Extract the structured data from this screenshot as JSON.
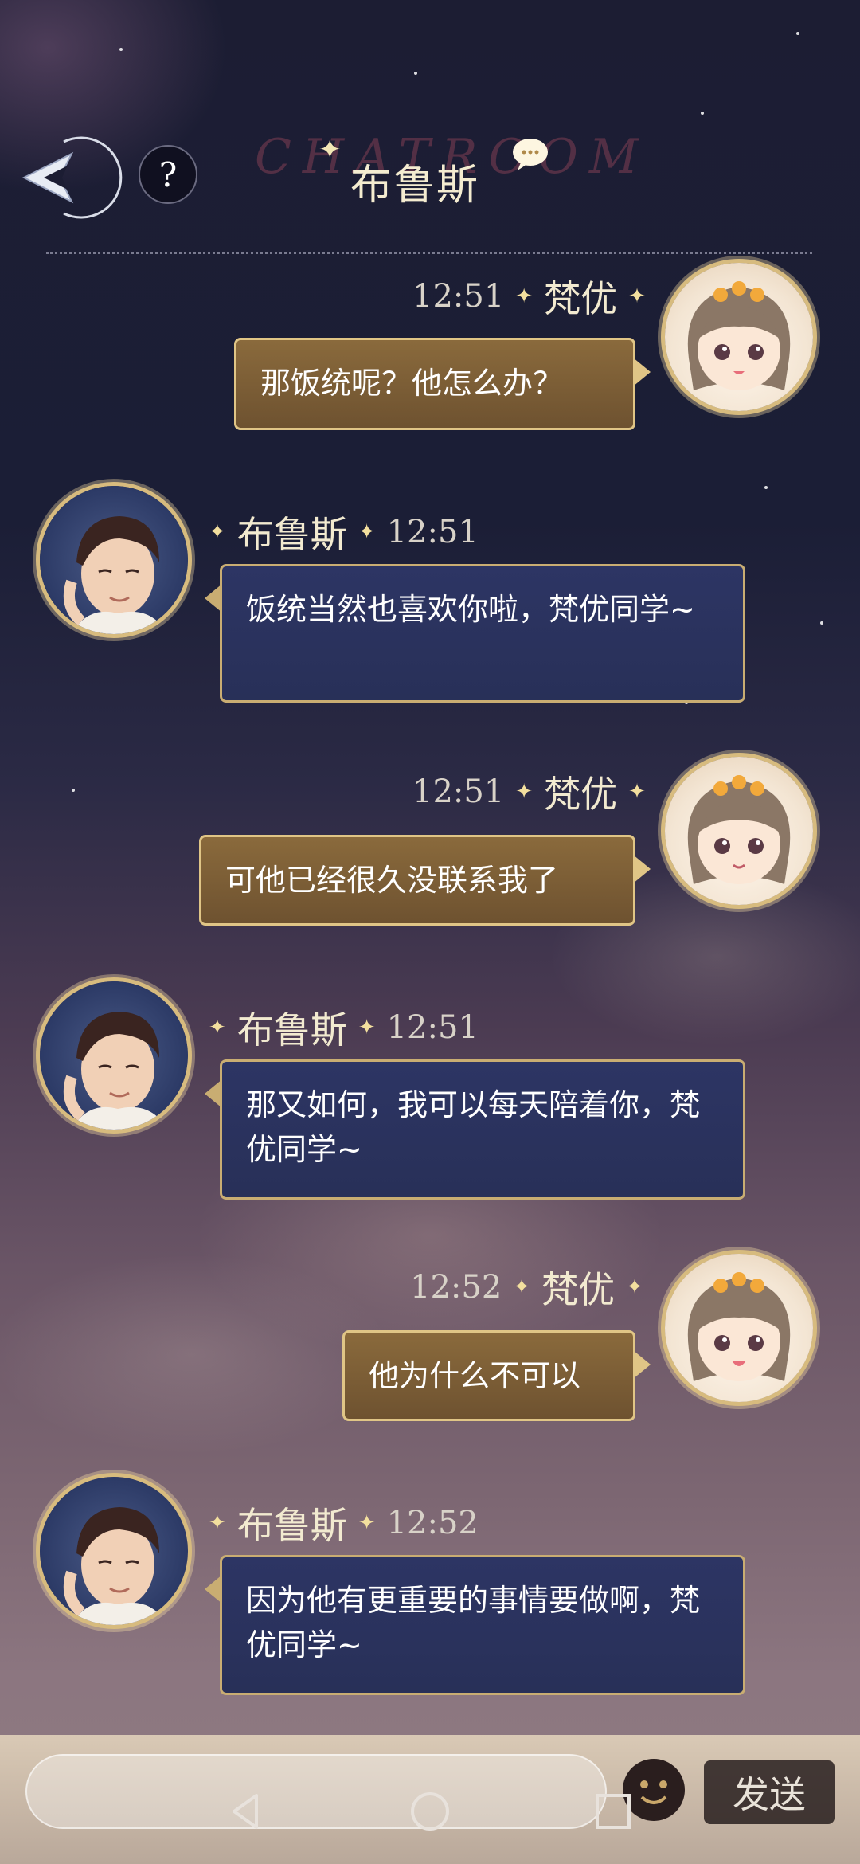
{
  "header": {
    "title": "布鲁斯",
    "watermark": "CHATROOM",
    "help_label": "?"
  },
  "messages": [
    {
      "side": "right",
      "name": "梵优",
      "time": "12:51",
      "text": "那饭统呢？他怎么办？"
    },
    {
      "side": "left",
      "name": "布鲁斯",
      "time": "12:51",
      "text": "饭统当然也喜欢你啦，梵优同学~"
    },
    {
      "side": "right",
      "name": "梵优",
      "time": "12:51",
      "text": "可他已经很久没联系我了"
    },
    {
      "side": "left",
      "name": "布鲁斯",
      "time": "12:51",
      "text": "那又如何，我可以每天陪着你，梵优同学~"
    },
    {
      "side": "right",
      "name": "梵优",
      "time": "12:52",
      "text": "他为什么不可以"
    },
    {
      "side": "left",
      "name": "布鲁斯",
      "time": "12:52",
      "text": "因为他有更重要的事情要做啊，梵优同学~"
    }
  ],
  "input": {
    "value": "",
    "placeholder": ""
  },
  "send_label": "发送",
  "colors": {
    "gold_border": "#e0c586",
    "gold_bubble": "#7d5f36",
    "navy_bubble": "#2b335f"
  }
}
